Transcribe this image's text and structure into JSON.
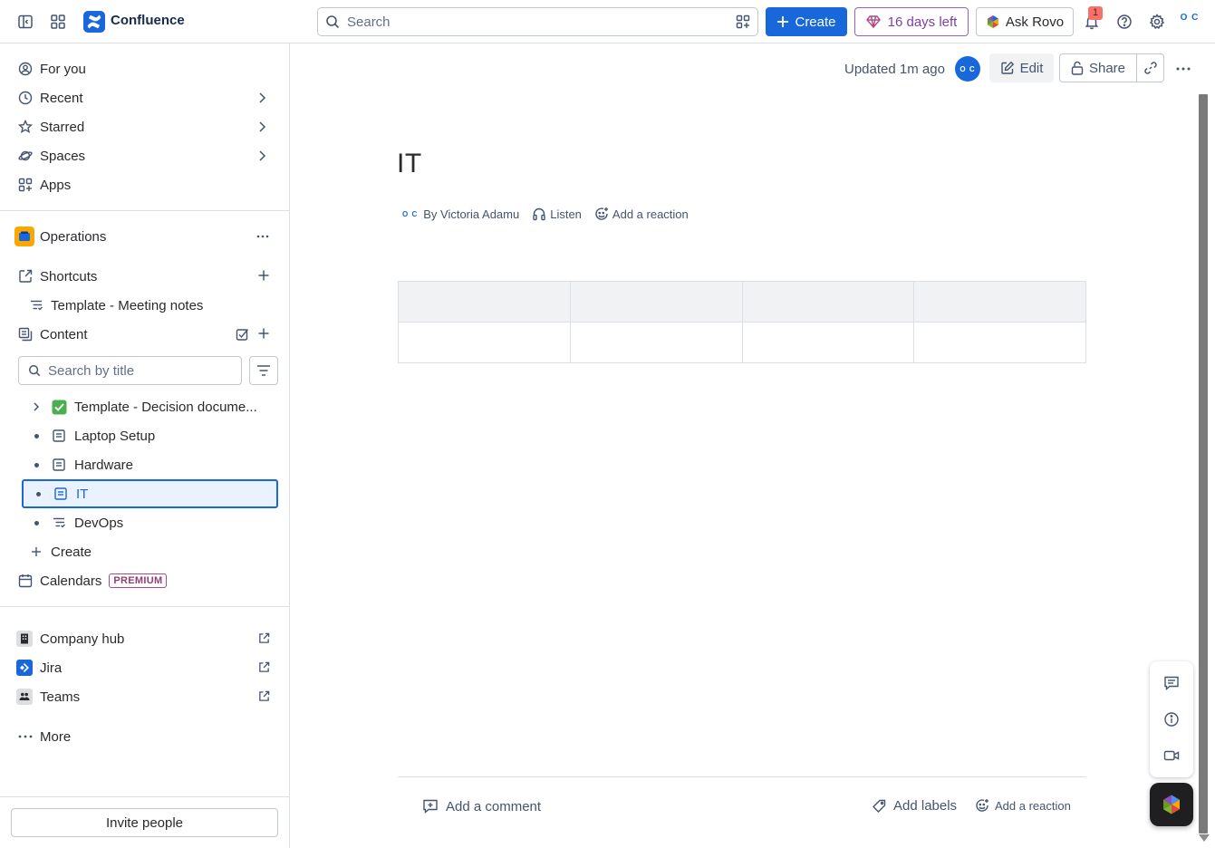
{
  "topbar": {
    "brand": "Confluence",
    "search_placeholder": "Search",
    "create_label": "Create",
    "trial_label": "16 days left",
    "rovo_label": "Ask Rovo",
    "notification_count": "1",
    "avatar_initials": "O C"
  },
  "sidebar": {
    "nav": [
      {
        "label": "For you"
      },
      {
        "label": "Recent"
      },
      {
        "label": "Starred"
      },
      {
        "label": "Spaces"
      },
      {
        "label": "Apps"
      }
    ],
    "space_name": "Operations",
    "shortcuts_label": "Shortcuts",
    "shortcut_items": [
      {
        "label": "Template - Meeting notes"
      }
    ],
    "content_label": "Content",
    "search_placeholder": "Search by title",
    "tree": [
      {
        "label": "Template - Decision docume..."
      },
      {
        "label": "Laptop Setup"
      },
      {
        "label": "Hardware"
      },
      {
        "label": "IT"
      },
      {
        "label": "DevOps"
      }
    ],
    "create_label": "Create",
    "calendars_label": "Calendars",
    "premium_badge": "PREMIUM",
    "apps": [
      {
        "label": "Company hub"
      },
      {
        "label": "Jira"
      },
      {
        "label": "Teams"
      }
    ],
    "more_label": "More",
    "invite_label": "Invite people"
  },
  "page": {
    "updated": "Updated 1m ago",
    "avatar_initials": "O C",
    "edit_label": "Edit",
    "share_label": "Share",
    "title": "IT",
    "byline_avatar": "O C",
    "byline_author": "By Victoria Adamu",
    "listen_label": "Listen",
    "reaction_label": "Add a reaction",
    "add_comment_label": "Add a comment",
    "add_labels_label": "Add labels",
    "footer_reaction_label": "Add a reaction"
  },
  "colors": {
    "brand_blue": "#1868DB",
    "trial_purple": "#803FA5",
    "selected_bg": "#E9F2FE"
  }
}
